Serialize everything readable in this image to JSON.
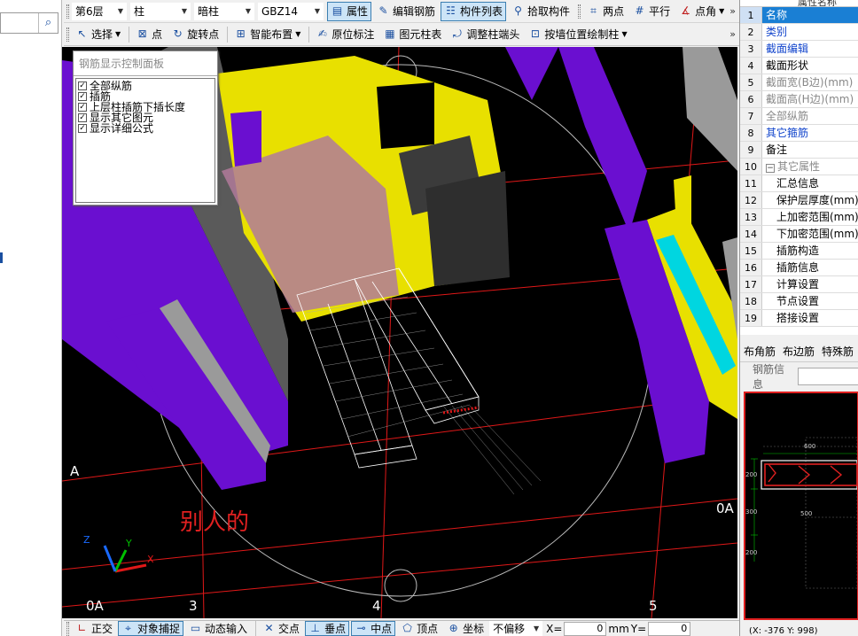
{
  "toolbar1": {
    "floor": "第6层",
    "category": "柱",
    "subtype": "暗柱",
    "component": "GBZ14",
    "attr_label": "属性",
    "edit_rebar_label": "编辑钢筋",
    "component_list_label": "构件列表",
    "pick_label": "拾取构件",
    "two_point_label": "两点",
    "parallel_label": "平行",
    "point_angle_label": "点角"
  },
  "toolbar2": {
    "select_label": "选择",
    "point_label": "点",
    "rotate_point_label": "旋转点",
    "smart_layout_label": "智能布置",
    "origin_mark_label": "原位标注",
    "table_label": "图元柱表",
    "adjust_head_label": "调整柱端头",
    "draw_by_wall_label": "按墙位置绘制柱"
  },
  "rebar_panel": {
    "title": "钢筋显示控制面板",
    "items": [
      "全部纵筋",
      "插筋",
      "上层柱插筋下插长度",
      "显示其它图元",
      "显示详细公式"
    ]
  },
  "viewport": {
    "annotation": "别人的",
    "axis_labels": {
      "a": "A",
      "oa_left": "0A",
      "oa_right": "0A",
      "n3": "3",
      "n4": "4",
      "n5": "5"
    },
    "axes": {
      "x": "X",
      "y": "Y",
      "z": "Z"
    },
    "colors": {
      "purple": "#6a0fd0",
      "yellow": "#e8e000",
      "gray": "#8a8a8a",
      "cyan": "#00d6e0",
      "red": "#e01818",
      "bg": "#000000"
    }
  },
  "status_bar": {
    "ortho_label": "正交",
    "snap_label": "对象捕捉",
    "dynamic_input_label": "动态输入",
    "intersection_label": "交点",
    "perpendicular_label": "垂点",
    "midpoint_label": "中点",
    "vertex_label": "顶点",
    "coord_label": "坐标",
    "offset_label": "不偏移",
    "x_label": "X=",
    "x_value": "0",
    "unit": "mm",
    "y_label": "Y=",
    "y_value": "0"
  },
  "properties": {
    "header": "属性名称",
    "rows": [
      {
        "num": "1",
        "label": "名称"
      },
      {
        "num": "2",
        "label": "类别"
      },
      {
        "num": "3",
        "label": "截面编辑"
      },
      {
        "num": "4",
        "label": "截面形状"
      },
      {
        "num": "5",
        "label": "截面宽(B边)(mm)"
      },
      {
        "num": "6",
        "label": "截面高(H边)(mm)"
      },
      {
        "num": "7",
        "label": "全部纵筋"
      },
      {
        "num": "8",
        "label": "其它箍筋"
      },
      {
        "num": "9",
        "label": "备注"
      },
      {
        "num": "10",
        "label": "其它属性"
      },
      {
        "num": "11",
        "label": "汇总信息"
      },
      {
        "num": "12",
        "label": "保护层厚度(mm)"
      },
      {
        "num": "13",
        "label": "上加密范围(mm)"
      },
      {
        "num": "14",
        "label": "下加密范围(mm)"
      },
      {
        "num": "15",
        "label": "插筋构造"
      },
      {
        "num": "16",
        "label": "插筋信息"
      },
      {
        "num": "17",
        "label": "计算设置"
      },
      {
        "num": "18",
        "label": "节点设置"
      },
      {
        "num": "19",
        "label": "搭接设置"
      }
    ],
    "collapse_sign": "−"
  },
  "right_tabs": {
    "corner": "布角筋",
    "edge": "布边筋",
    "special": "特殊筋"
  },
  "rebar_info_label": "钢筋信息",
  "preview": {
    "dim_600": "600",
    "dim_200a": "200",
    "dim_300": "300",
    "dim_200b": "200",
    "dim_500": "500"
  },
  "coords": "(X: -376 Y: 998)"
}
